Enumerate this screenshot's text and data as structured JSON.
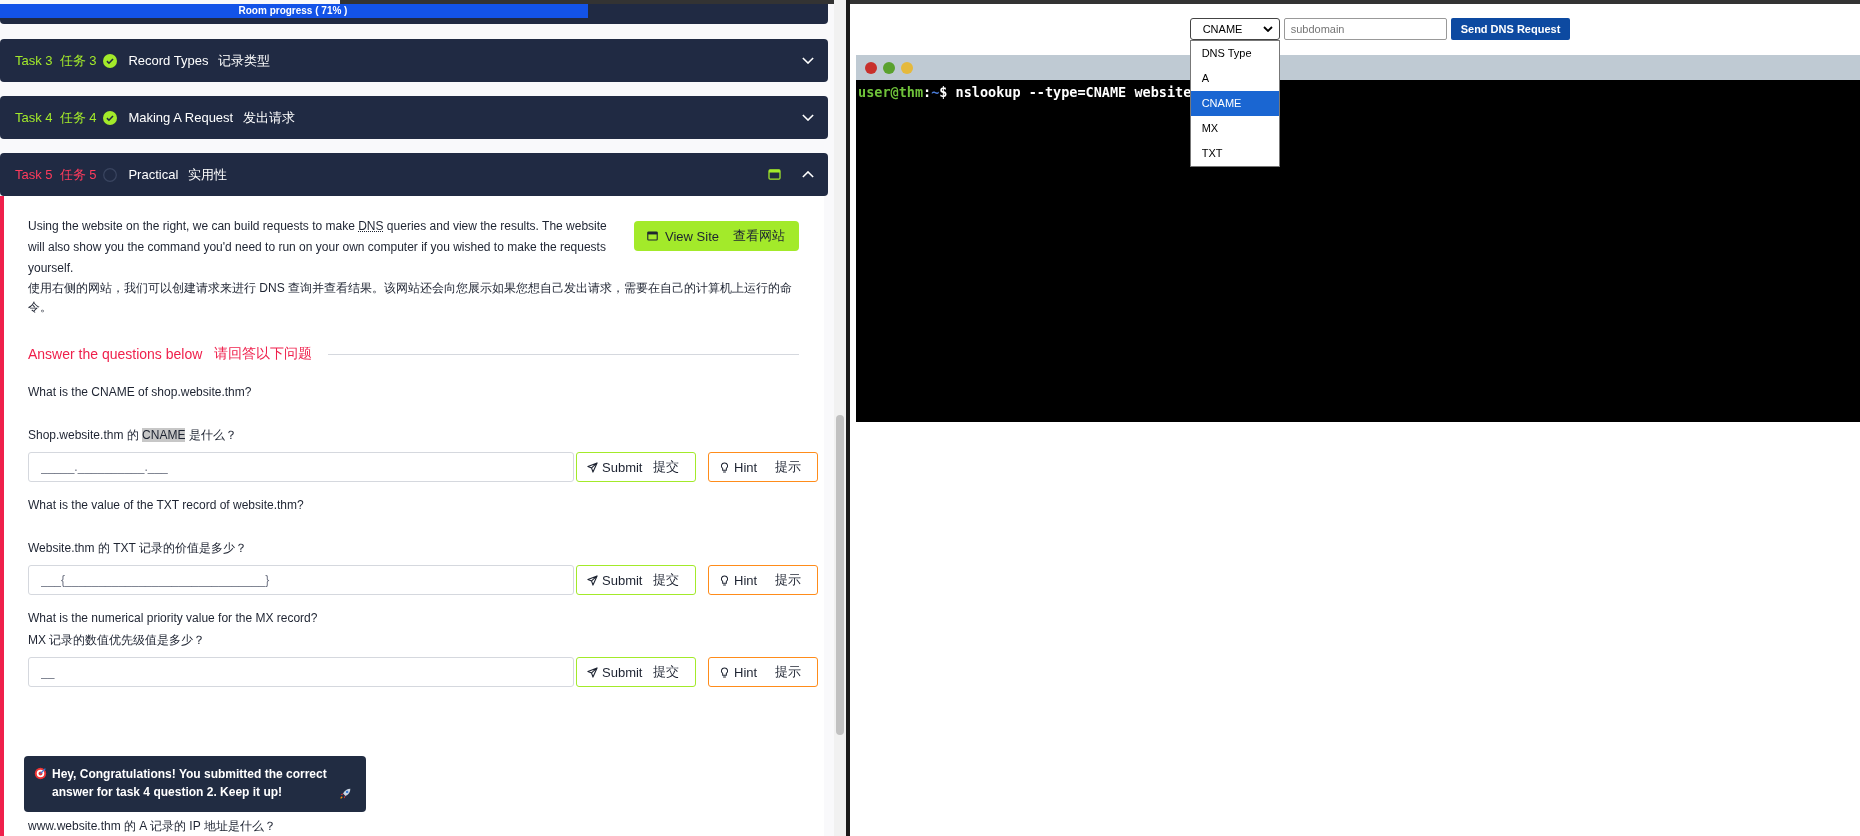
{
  "progress": {
    "label": "Room progress ( 71% )",
    "level": 0.71
  },
  "tasks": [
    {
      "label": "Task 3",
      "label_zh": "任务 3",
      "done": true,
      "title": "Record Types",
      "title_zh": "记录类型",
      "expanded": false
    },
    {
      "label": "Task 4",
      "label_zh": "任务 4",
      "done": true,
      "title": "Making A Request",
      "title_zh": "发出请求",
      "expanded": false
    },
    {
      "label": "Task 5",
      "label_zh": "任务 5",
      "done": false,
      "title": "Practical",
      "title_zh": "实用性",
      "expanded": true
    }
  ],
  "task_body": {
    "paragraph_before": "Using the website on the right, we can build requests to make ",
    "abbr": "DNS",
    "paragraph_after": " queries and view the results. The website will also show you the command you'd need to run on your own computer if you wished to make the requests yourself.",
    "paragraph_zh": "使用右侧的网站，我们可以创建请求来进行 DNS 查询并查看结果。该网站还会向您展示如果您想自己发出请求，需要在自己的计算机上运行的命令。",
    "view_site": {
      "label": "View Site",
      "label_zh": "查看网站"
    },
    "answers_heading": {
      "en": "Answer the questions below",
      "zh": "请回答以下问题"
    }
  },
  "questions": [
    {
      "kind": "spaced",
      "en": "What is the CNAME of shop.website.thm?",
      "zh_before": "Shop.website.thm 的 ",
      "zh_selected": "CNAME",
      "zh_after": " 是什么？",
      "placeholder": "_____.__________.___",
      "submit": "Submit",
      "submit_zh": "提交",
      "hint": "Hint",
      "hint_zh": "提示"
    },
    {
      "kind": "spaced",
      "en": "What is the value of the TXT record of website.thm?",
      "zh_before": "Website.thm 的 TXT 记录的价值是多少？",
      "placeholder": "___{______________________________}",
      "submit": "Submit",
      "submit_zh": "提交",
      "hint": "Hint",
      "hint_zh": "提示"
    },
    {
      "kind": "compact",
      "en": "What is the numerical priority value for the MX record?",
      "zh_before": "MX 记录的数值优先级值是多少？",
      "placeholder": "__",
      "submit": "Submit",
      "submit_zh": "提交",
      "hint": "Hint",
      "hint_zh": "提示"
    }
  ],
  "partial_question": "www.website.thm 的 A 记录的 IP 地址是什么？",
  "toast": {
    "text": "Hey, Congratulations! You submitted the correct answer for task 4 question 2. Keep it up!"
  },
  "dns_form": {
    "select_value": "CNAME",
    "subdomain_placeholder": "subdomain",
    "send_button": "Send DNS Request",
    "options": [
      {
        "label": "DNS Type",
        "selected": false
      },
      {
        "label": "A",
        "selected": false
      },
      {
        "label": "CNAME",
        "selected": true
      },
      {
        "label": "MX",
        "selected": false
      },
      {
        "label": "TXT",
        "selected": false
      }
    ]
  },
  "terminal": {
    "user": "user@thm",
    "separator": ":",
    "path": "~",
    "prompt": "$",
    "command": "nslookup --type=CNAME website"
  }
}
